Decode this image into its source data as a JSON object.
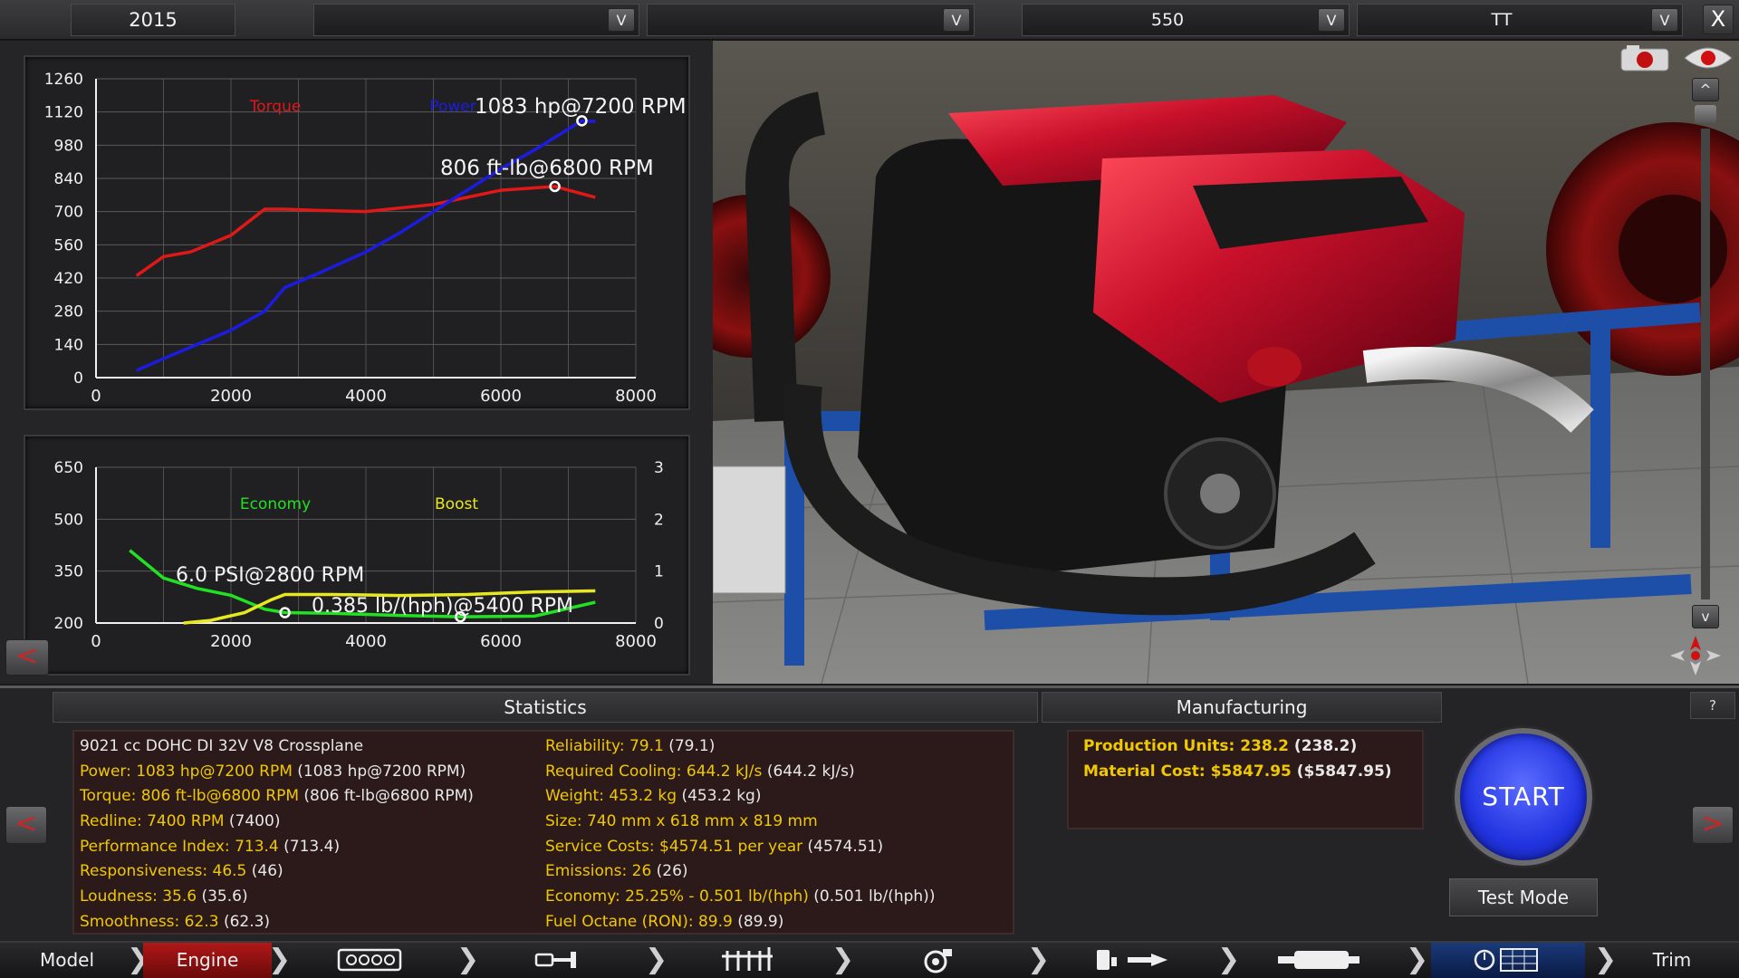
{
  "topbar": {
    "year": "2015",
    "selectors": [
      {
        "value": "",
        "dropdown": "V"
      },
      {
        "value": "",
        "dropdown": "V"
      },
      {
        "value": "550",
        "dropdown": "V"
      },
      {
        "value": "TT",
        "dropdown": "V"
      }
    ],
    "close": "X"
  },
  "charts": [
    {
      "type": "line",
      "series": [
        {
          "name": "Torque",
          "color": "#e01818",
          "axis": "left",
          "x": [
            600,
            1000,
            1400,
            2000,
            2500,
            2800,
            3300,
            4000,
            5000,
            6000,
            6800,
            7400
          ],
          "y": [
            430,
            510,
            530,
            600,
            710,
            710,
            705,
            700,
            730,
            790,
            806,
            760
          ]
        },
        {
          "name": "Power",
          "color": "#1c1ce0",
          "axis": "left",
          "x": [
            600,
            1000,
            1500,
            2000,
            2500,
            2800,
            3300,
            4000,
            4500,
            5000,
            5500,
            6000,
            6500,
            7200,
            7400
          ],
          "y": [
            30,
            80,
            140,
            200,
            280,
            380,
            440,
            530,
            610,
            700,
            790,
            880,
            960,
            1083,
            1080
          ]
        }
      ],
      "xlim": [
        0,
        8000
      ],
      "ylim": [
        0,
        1260
      ],
      "xticks": [
        "0",
        "2000",
        "4000",
        "6000",
        "8000"
      ],
      "yticks": [
        "0",
        "140",
        "280",
        "420",
        "560",
        "700",
        "840",
        "980",
        "1120",
        "1260"
      ],
      "annotations": [
        {
          "text": "1083 hp@7200 RPM",
          "x": 7200,
          "y": 1083
        },
        {
          "text": "806 ft-lb@6800 RPM",
          "x": 6800,
          "y": 806
        }
      ],
      "grid": true
    },
    {
      "type": "line",
      "series": [
        {
          "name": "Economy",
          "color": "#22e022",
          "axis": "left",
          "x": [
            500,
            1000,
            1500,
            2000,
            2500,
            2800,
            3500,
            4500,
            5400,
            6500,
            7400
          ],
          "y": [
            410,
            330,
            300,
            280,
            240,
            230,
            228,
            222,
            218,
            220,
            260
          ]
        },
        {
          "name": "Boost",
          "color": "#e8e820",
          "axis": "right",
          "x": [
            1300,
            1700,
            2200,
            2600,
            2800,
            3500,
            4500,
            5500,
            6500,
            7400
          ],
          "y": [
            0,
            0.05,
            0.2,
            0.45,
            0.55,
            0.55,
            0.53,
            0.55,
            0.6,
            0.62
          ]
        }
      ],
      "xlim": [
        0,
        8000
      ],
      "ylim": [
        200,
        650
      ],
      "ylim_right": [
        0,
        3
      ],
      "xticks": [
        "0",
        "2000",
        "4000",
        "6000",
        "8000"
      ],
      "yticks": [
        "200",
        "350",
        "500",
        "650"
      ],
      "yticks_right": [
        "0",
        "1",
        "2",
        "3"
      ],
      "annotations": [
        {
          "text": "6.0 PSI@2800 RPM",
          "x": 2800,
          "y": 230
        },
        {
          "text": "0.385 lb/(hph)@5400 RPM",
          "x": 5400,
          "y": 218
        }
      ],
      "grid": true
    }
  ],
  "chart_labels": {
    "torque": "Torque",
    "power": "Power",
    "economy": "Economy",
    "boost": "Boost"
  },
  "statistics": {
    "title": "Statistics",
    "left": [
      {
        "label": "9021 cc DOHC DI 32V V8 Crossplane",
        "value": ""
      },
      {
        "label": "Power: 1083 hp@7200 RPM",
        "value": "(1083 hp@7200 RPM)"
      },
      {
        "label": "Torque: 806 ft-lb@6800 RPM",
        "value": "(806 ft-lb@6800 RPM)"
      },
      {
        "label": "Redline: 7400 RPM",
        "value": "(7400)"
      },
      {
        "label": "Performance Index: 713.4",
        "value": "(713.4)"
      },
      {
        "label": "Responsiveness: 46.5",
        "value": "(46)"
      },
      {
        "label": "Loudness: 35.6",
        "value": "(35.6)"
      },
      {
        "label": "Smoothness: 62.3",
        "value": "(62.3)"
      }
    ],
    "right": [
      {
        "label": "Reliability: 79.1",
        "value": "(79.1)"
      },
      {
        "label": "Required Cooling: 644.2 kJ/s",
        "value": "(644.2 kJ/s)"
      },
      {
        "label": "Weight: 453.2 kg",
        "value": "(453.2 kg)"
      },
      {
        "label": "Size: 740 mm x 618 mm x 819 mm",
        "value": ""
      },
      {
        "label": "Service Costs: $4574.51 per year",
        "value": "(4574.51)"
      },
      {
        "label": "Emissions: 26",
        "value": "(26)"
      },
      {
        "label": "Economy: 25.25% - 0.501 lb/(hph)",
        "value": "(0.501 lb/(hph))"
      },
      {
        "label": "Fuel Octane (RON): 89.9",
        "value": "(89.9)"
      }
    ]
  },
  "manufacturing": {
    "title": "Manufacturing",
    "lines": [
      {
        "label": "Production Units: 238.2",
        "value": "(238.2)"
      },
      {
        "label": "Material Cost: $5847.95",
        "value": "($5847.95)"
      }
    ]
  },
  "buttons": {
    "start": "START",
    "test_mode": "Test Mode",
    "help": "?",
    "prev": "<",
    "next": ">",
    "scroll_up": "^",
    "scroll_down": "v"
  },
  "tabs": [
    {
      "label": "Model",
      "icon": ""
    },
    {
      "label": "Engine",
      "icon": ""
    },
    {
      "label": "",
      "icon": "engine-block-icon"
    },
    {
      "label": "",
      "icon": "crankshaft-icon"
    },
    {
      "label": "",
      "icon": "cylinder-heads-icon"
    },
    {
      "label": "",
      "icon": "turbo-icon"
    },
    {
      "label": "",
      "icon": "fuel-system-icon"
    },
    {
      "label": "",
      "icon": "exhaust-icon"
    },
    {
      "label": "",
      "icon": "tuning-icon"
    },
    {
      "label": "Trim",
      "icon": ""
    }
  ],
  "colors": {
    "accent_red": "#c62828",
    "start_blue": "#2234e0",
    "stat_yellow": "#f0c800"
  }
}
